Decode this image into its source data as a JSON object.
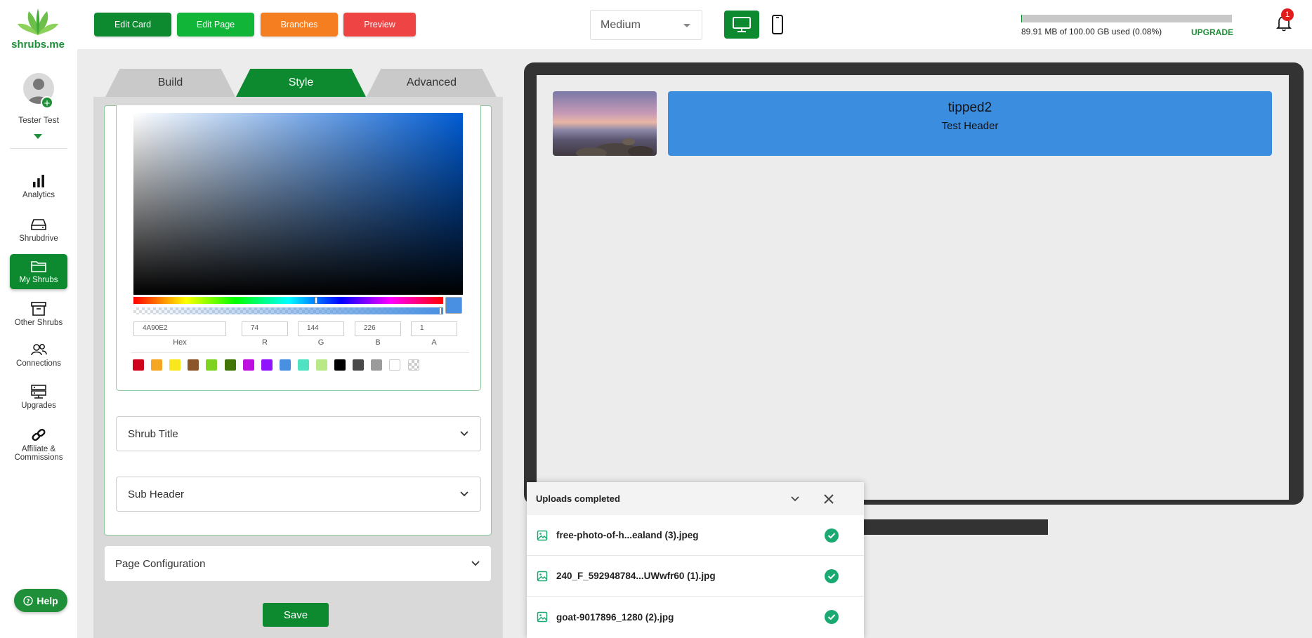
{
  "brand": {
    "logo_text": "shrubs.me"
  },
  "user": {
    "name": "Tester Test"
  },
  "sidebar": {
    "items": [
      {
        "label": "Analytics",
        "icon": "analytics-icon"
      },
      {
        "label": "Shrubdrive",
        "icon": "drive-icon"
      },
      {
        "label": "My Shrubs",
        "icon": "folder-icon",
        "active": true
      },
      {
        "label": "Other Shrubs",
        "icon": "archive-icon"
      },
      {
        "label": "Connections",
        "icon": "users-icon"
      },
      {
        "label": "Upgrades",
        "icon": "server-icon"
      },
      {
        "label": "Affiliate & Commissions",
        "icon": "link-icon"
      }
    ],
    "help_label": "Help"
  },
  "toolbar": {
    "edit_card": "Edit Card",
    "edit_page": "Edit Page",
    "branches": "Branches",
    "preview": "Preview",
    "size_value": "Medium",
    "storage_text": "89.91 MB of 100.00 GB used (0.08%)",
    "storage_fraction": 0.0008,
    "upgrade_label": "UPGRADE",
    "notification_count": "1"
  },
  "editor": {
    "tabs": [
      "Build",
      "Style",
      "Advanced"
    ],
    "active_tab": "Style",
    "color": {
      "hex": "4A90E2",
      "r": "74",
      "g": "144",
      "b": "226",
      "a": "1",
      "labels": {
        "hex": "Hex",
        "r": "R",
        "g": "G",
        "b": "B",
        "a": "A"
      },
      "swatches": [
        "#d0021b",
        "#f5a623",
        "#f8e71c",
        "#8b572a",
        "#7ed321",
        "#417505",
        "#bd10e0",
        "#9013fe",
        "#4a90e2",
        "#50e3c2",
        "#b8e986",
        "#000000",
        "#4a4a4a",
        "#9b9b9b",
        "#ffffff",
        "transparent"
      ]
    },
    "accordions": [
      "Shrub Title",
      "Sub Header"
    ],
    "page_config": "Page Configuration",
    "save_label": "Save"
  },
  "preview": {
    "title": "tipped2",
    "subheader": "Test Header"
  },
  "uploads": {
    "title": "Uploads completed",
    "files": [
      "free-photo-of-h...ealand (3).jpeg",
      "240_F_592948784...UWwfr60 (1).jpg",
      "goat-9017896_1280 (2).jpg"
    ]
  },
  "colors": {
    "brand_green": "#0d8a2f",
    "accent_blue": "#4a90e2",
    "orange": "#f57f20",
    "red": "#ef4444"
  }
}
